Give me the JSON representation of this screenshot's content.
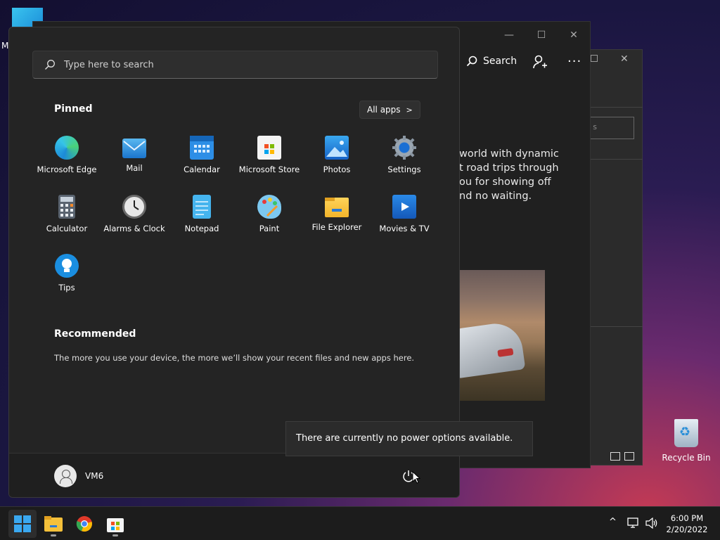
{
  "desktop": {
    "top_left_label": "M",
    "recycle_bin_label": "Recycle Bin"
  },
  "background_window": {
    "search_label": "Search",
    "more_label": "···",
    "article_lines": [
      "world with dynamic",
      "t road trips through",
      "ou for showing off",
      "nd no waiting."
    ],
    "partial_text": "s"
  },
  "start_menu": {
    "search_placeholder": "Type here to search",
    "pinned_title": "Pinned",
    "all_apps_label": "All apps",
    "pinned_apps": [
      {
        "name": "Microsoft Edge",
        "icon": "edge-icon"
      },
      {
        "name": "Mail",
        "icon": "mail-icon"
      },
      {
        "name": "Calendar",
        "icon": "calendar-icon"
      },
      {
        "name": "Microsoft Store",
        "icon": "store-icon"
      },
      {
        "name": "Photos",
        "icon": "photos-icon"
      },
      {
        "name": "Settings",
        "icon": "gear-icon"
      },
      {
        "name": "Calculator",
        "icon": "calculator-icon"
      },
      {
        "name": "Alarms & Clock",
        "icon": "clock-icon"
      },
      {
        "name": "Notepad",
        "icon": "notepad-icon"
      },
      {
        "name": "Paint",
        "icon": "paint-icon"
      },
      {
        "name": "File Explorer",
        "icon": "folder-icon"
      },
      {
        "name": "Movies & TV",
        "icon": "movies-icon"
      },
      {
        "name": "Tips",
        "icon": "tips-icon"
      }
    ],
    "recommended_title": "Recommended",
    "recommended_text": "The more you use your device, the more we’ll show your recent files and new apps here.",
    "user_name": "VM6"
  },
  "tooltip": {
    "text": "There are currently no power options available."
  },
  "taskbar": {
    "time": "6:00 PM",
    "date": "2/20/2022"
  }
}
